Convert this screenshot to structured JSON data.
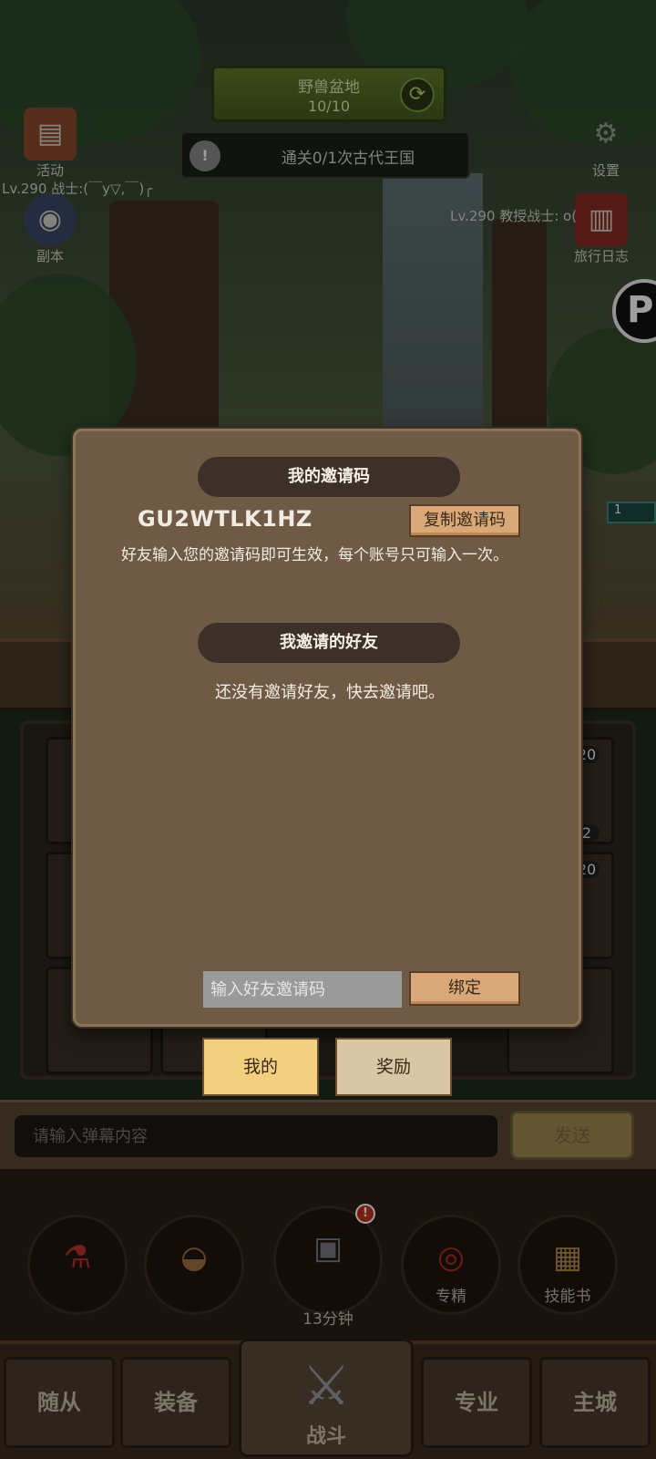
{
  "map": {
    "name": "野兽盆地",
    "progress": "10/10",
    "refresh_icon": "refresh-icon"
  },
  "quest": {
    "text": "通关0/1次古代王国",
    "icon": "exclamation-icon"
  },
  "left_buttons": [
    {
      "label": "活动",
      "icon": "chest-icon"
    },
    {
      "label": "副本",
      "icon": "portal-icon"
    }
  ],
  "right_buttons": [
    {
      "label": "设置",
      "icon": "gear-icon"
    },
    {
      "label": "旅行日志",
      "icon": "journal-icon"
    }
  ],
  "players": {
    "left": "Lv.290 战士:(￣y▽,￣)╭",
    "right": "Lv.290 教授战士: o("
  },
  "edge": {
    "p_label": "P",
    "tag": "1"
  },
  "slots": {
    "a": "20",
    "b": "2",
    "c": "20"
  },
  "invite_modal": {
    "my_code_title": "我的邀请码",
    "code": "GU2WTLK1HZ",
    "copy_button": "复制邀请码",
    "description": "好友输入您的邀请码即可生效，每个账号只可输入一次。",
    "friends_title": "我邀请的好友",
    "empty_message": "还没有邀请好友，快去邀请吧。",
    "friend_input_placeholder": "输入好友邀请码",
    "bind_button": "绑定"
  },
  "modal_tabs": [
    {
      "label": "我的",
      "active": true
    },
    {
      "label": "奖励",
      "active": false
    }
  ],
  "chat": {
    "placeholder": "请输入弹幕内容",
    "send": "发送"
  },
  "skills": [
    {
      "label": "",
      "icon": "potion-icon"
    },
    {
      "label": "",
      "icon": "bread-icon"
    },
    {
      "label": "",
      "icon": "treasure-chest-icon"
    },
    {
      "label": "专精",
      "icon": "mastery-icon"
    },
    {
      "label": "技能书",
      "icon": "skill-book-icon"
    }
  ],
  "chest_timer": "13分钟",
  "chest_badge": "!",
  "nav": [
    {
      "label": "随从"
    },
    {
      "label": "装备"
    },
    {
      "label": "战斗",
      "icon": "crossed-swords-icon"
    },
    {
      "label": "专业"
    },
    {
      "label": "主城"
    }
  ],
  "colors": {
    "modal_bg": "#6f5a46",
    "pill_bg": "#3d3028",
    "parchment": "#d8a878",
    "tab_active": "#f2d080",
    "tab_inactive": "#d8c6a4"
  }
}
